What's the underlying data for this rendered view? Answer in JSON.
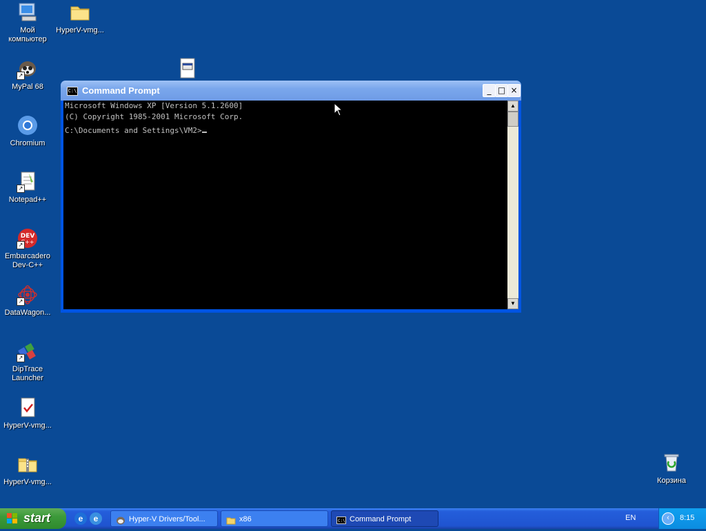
{
  "desktop": {
    "background_color": "#0a4a96",
    "icons": [
      {
        "label": "Мой компьютер",
        "icon": "my-computer-icon"
      },
      {
        "label": "HyperV-vmg...",
        "icon": "folder-icon"
      },
      {
        "label": "MyPal 68",
        "icon": "mypal-icon"
      },
      {
        "label": "Chromium",
        "icon": "chromium-icon"
      },
      {
        "label": "Notepad++",
        "icon": "notepadpp-icon"
      },
      {
        "label": "Embarcadero Dev-C++",
        "icon": "devcpp-icon"
      },
      {
        "label": "DataWagon...",
        "icon": "datawagon-icon"
      },
      {
        "label": "DipTrace Launcher",
        "icon": "diptrace-icon"
      },
      {
        "label": "HyperV-vmg...",
        "icon": "document-check-icon"
      },
      {
        "label": "HyperV-vmg...",
        "icon": "zip-folder-icon"
      },
      {
        "label": "Корзина",
        "icon": "recycle-bin-icon"
      }
    ]
  },
  "window": {
    "title": "Command Prompt",
    "controls": {
      "minimize": "_",
      "maximize": "□",
      "close": "×"
    },
    "console_lines": [
      "Microsoft Windows XP [Version 5.1.2600]",
      "(C) Copyright 1985-2001 Microsoft Corp.",
      "",
      "C:\\Documents and Settings\\VM2>"
    ]
  },
  "taskbar": {
    "start_label": "start",
    "tasks": [
      {
        "label": "Hyper-V Drivers/Tool...",
        "icon": "hyperv-drivers-icon"
      },
      {
        "label": "x86",
        "icon": "folder-icon"
      },
      {
        "label": "Command Prompt",
        "icon": "cmd-icon",
        "active": true
      }
    ],
    "language": "EN",
    "clock": "8:15"
  }
}
